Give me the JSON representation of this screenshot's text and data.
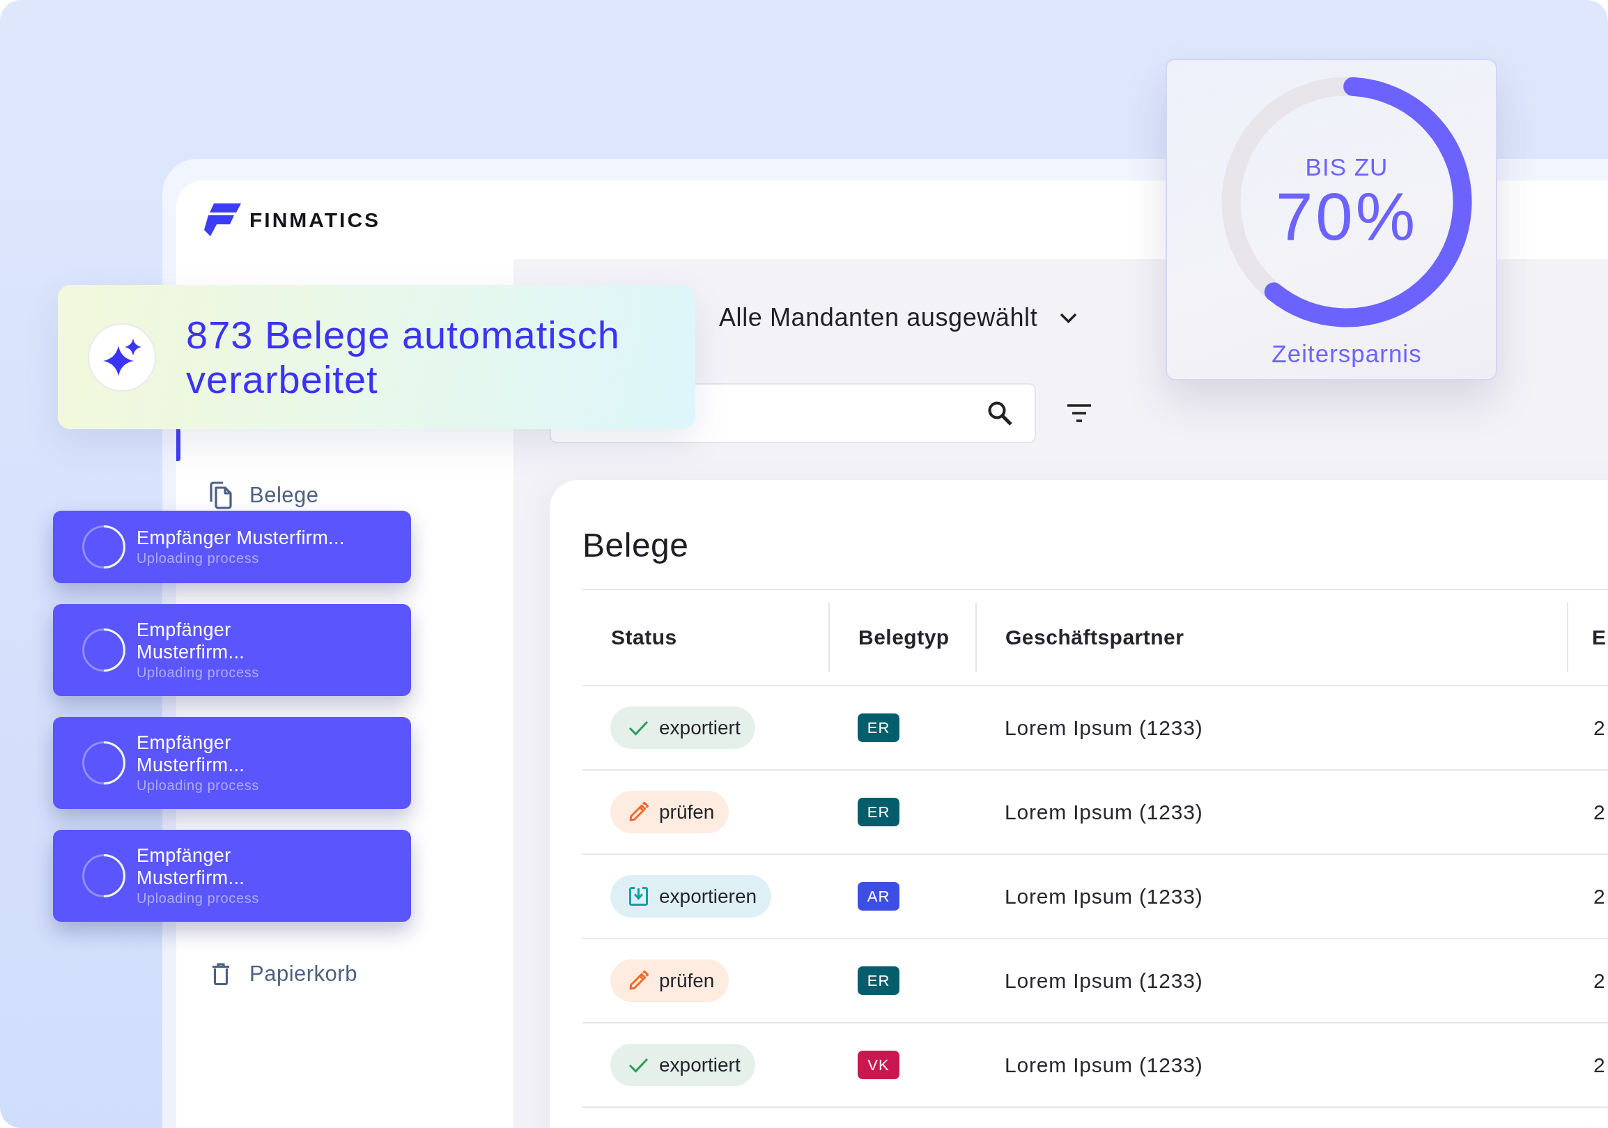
{
  "brand": {
    "name": "FINMATICS"
  },
  "notification": {
    "text": "873 Belege automatisch verarbeitet"
  },
  "savings_card": {
    "caption": "BIS ZU",
    "value": "70%",
    "label": "Zeitersparnis",
    "level": 0.6
  },
  "sidebar": {
    "items": [
      {
        "label": "Belege",
        "selected": false
      },
      {
        "label": "Papierkorb",
        "selected": false
      }
    ]
  },
  "toolbar": {
    "client_filter": "Alle Mandanten ausgewählt"
  },
  "uploads": [
    {
      "title": "Empfänger Musterfirm...",
      "subtitle": "Uploading process"
    },
    {
      "title": "Empfänger\nMusterfirm...",
      "subtitle": "Uploading process"
    },
    {
      "title": "Empfänger\nMusterfirm...",
      "subtitle": "Uploading process"
    },
    {
      "title": "Empfänger\nMusterfirm...",
      "subtitle": "Uploading process"
    }
  ],
  "table": {
    "title": "Belege",
    "columns": [
      "Status",
      "Belegtyp",
      "Geschäftspartner",
      "E"
    ],
    "rows": [
      {
        "status": {
          "kind": "exported",
          "label": "exportiert"
        },
        "document_type": {
          "label": "ER",
          "color": "#045d6a"
        },
        "business_partner": "Lorem Ipsum (1233)",
        "column_4": "2"
      },
      {
        "status": {
          "kind": "review",
          "label": "prüfen"
        },
        "document_type": {
          "label": "ER",
          "color": "#045d6a"
        },
        "business_partner": "Lorem Ipsum (1233)",
        "column_4": "2"
      },
      {
        "status": {
          "kind": "export",
          "label": "exportieren"
        },
        "document_type": {
          "label": "AR",
          "color": "#3d4fe3"
        },
        "business_partner": "Lorem Ipsum (1233)",
        "column_4": "2"
      },
      {
        "status": {
          "kind": "review",
          "label": "prüfen"
        },
        "document_type": {
          "label": "ER",
          "color": "#045d6a"
        },
        "business_partner": "Lorem Ipsum (1233)",
        "column_4": "2"
      },
      {
        "status": {
          "kind": "exported",
          "label": "exportiert"
        },
        "document_type": {
          "label": "VK",
          "color": "#c8184f"
        },
        "business_partner": "Lorem Ipsum (1233)",
        "column_4": "2"
      }
    ]
  }
}
